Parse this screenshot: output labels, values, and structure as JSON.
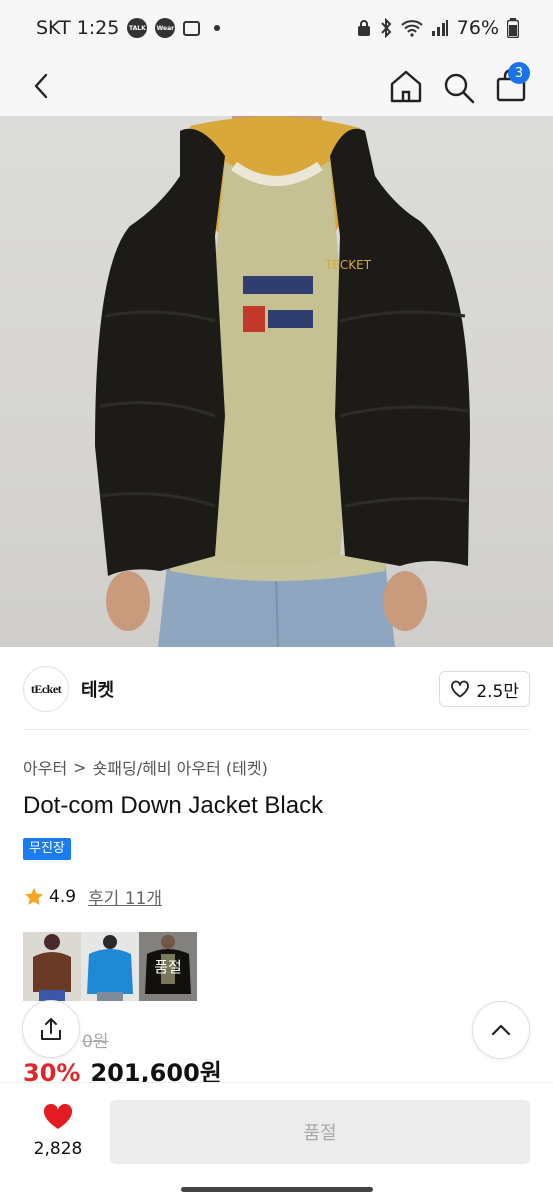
{
  "status_bar": {
    "carrier_time": "SKT 1:25",
    "talk_icon": "TALK",
    "wear_icon": "Wear",
    "battery": "76%"
  },
  "header": {
    "cart_count": "3"
  },
  "brand": {
    "logo_text": "tEcket",
    "name": "테켓",
    "likes": "2.5만"
  },
  "category": {
    "level1": "아우터",
    "separator": ">",
    "level2": "숏패딩/헤비 아우터 (테켓)"
  },
  "product": {
    "title": "Dot-com Down Jacket Black",
    "badge": "무진장",
    "rating": "4.9",
    "review_link": "후기 11개",
    "thumbnails": [
      {
        "color": "brown",
        "label": ""
      },
      {
        "color": "blue",
        "label": ""
      },
      {
        "color": "black",
        "label": "품절"
      }
    ],
    "original_price_visible": "0원",
    "discount": "30%",
    "sale_price": "201,600원"
  },
  "bottom_bar": {
    "wish_count": "2,828",
    "cta_label": "품절"
  },
  "icons": [
    "back-icon",
    "home-icon",
    "search-icon",
    "shopping-bag-icon",
    "heart-outline-icon",
    "star-icon",
    "share-icon",
    "chevron-up-icon",
    "heart-filled-icon"
  ],
  "colors": {
    "accent_blue": "#1b7cf0",
    "discount_red": "#e0262b",
    "heart_red": "#e31b23",
    "star_gold": "#f5a623"
  }
}
